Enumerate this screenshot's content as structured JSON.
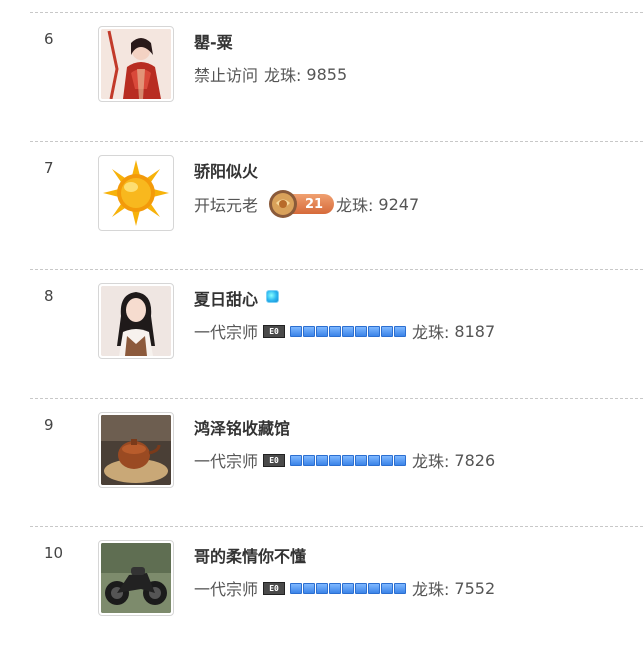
{
  "dragon_label": "龙珠:",
  "rows": [
    {
      "rank": "6",
      "name": "罌-粟",
      "title": "禁止访问",
      "points": "9855",
      "avatar": "woman-hanfu-avatar"
    },
    {
      "rank": "7",
      "name": "骄阳似火",
      "title": "开坛元老",
      "points": "9247",
      "avatar": "sun-avatar",
      "medal_level": "21"
    },
    {
      "rank": "8",
      "name": "夏日甜心",
      "title": "一代宗师",
      "points": "8187",
      "avatar": "girl-avatar",
      "badge": "E0"
    },
    {
      "rank": "9",
      "name": "鸿泽铭收藏馆",
      "title": "一代宗师",
      "points": "7826",
      "avatar": "teapot-avatar",
      "badge": "E0"
    },
    {
      "rank": "10",
      "name": "哥的柔情你不懂",
      "title": "一代宗师",
      "points": "7552",
      "avatar": "motorcycle-avatar",
      "badge": "E0"
    }
  ],
  "colors": {
    "divider": "#c8c8c8",
    "level_block": "#3b84e8",
    "medal": "#d66a3a",
    "vip": "#2bb6f0"
  }
}
